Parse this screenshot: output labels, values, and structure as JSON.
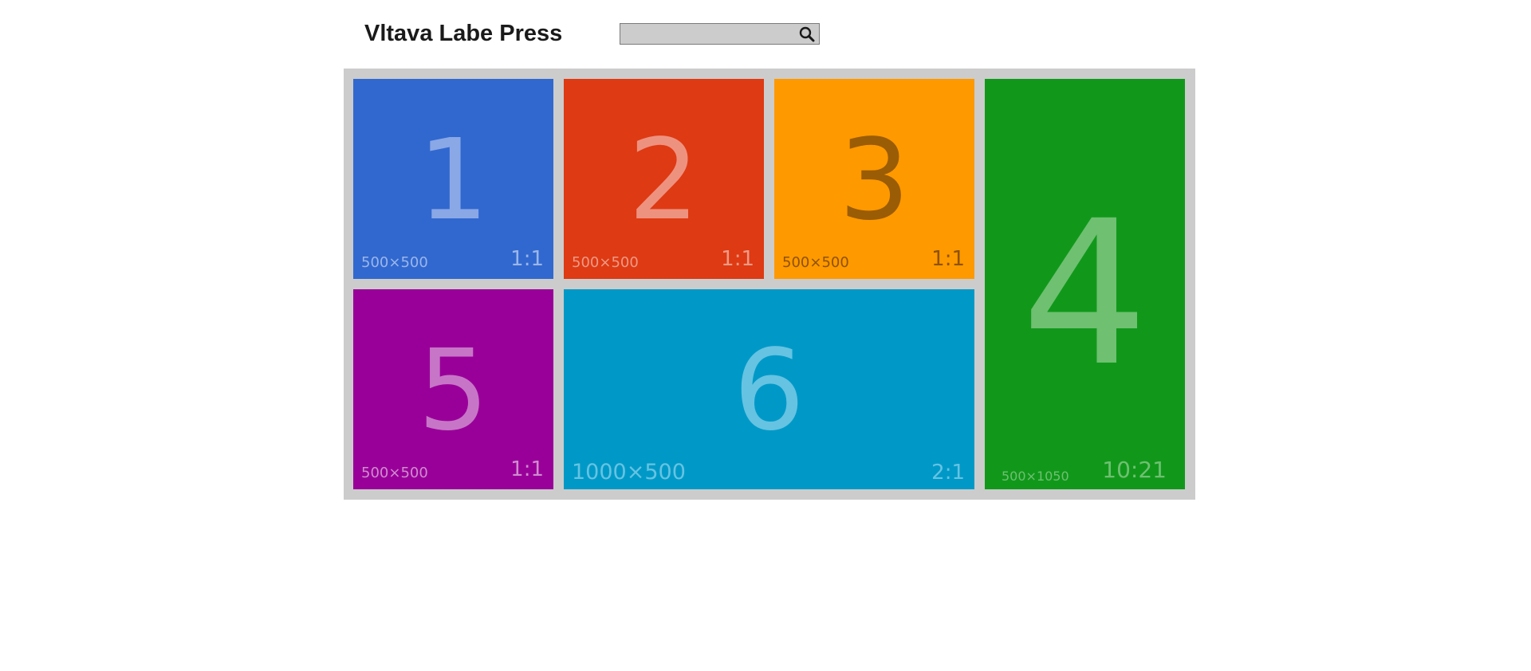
{
  "header": {
    "site_title": "Vltava Labe Press",
    "search_placeholder": "",
    "search_value": ""
  },
  "tiles": [
    {
      "number": "1",
      "dimensions": "500×500",
      "ratio": "1:1",
      "bg_color": "#3168cf",
      "number_color": "#8aa8e6",
      "label_color": "#9bb6ea"
    },
    {
      "number": "2",
      "dimensions": "500×500",
      "ratio": "1:1",
      "bg_color": "#de3a13",
      "number_color": "#ee9280",
      "label_color": "#ee9a86"
    },
    {
      "number": "3",
      "dimensions": "500×500",
      "ratio": "1:1",
      "bg_color": "#ff9900",
      "number_color": "#9a5c05",
      "label_color": "#8c5204"
    },
    {
      "number": "4",
      "dimensions": "500×1050",
      "ratio": "10:21",
      "bg_color": "#11981b",
      "number_color": "#6fc071",
      "label_color": "#6fc071"
    },
    {
      "number": "5",
      "dimensions": "500×500",
      "ratio": "1:1",
      "bg_color": "#990099",
      "number_color": "#c776c7",
      "label_color": "#cf8ccf"
    },
    {
      "number": "6",
      "dimensions": "1000×500",
      "ratio": "2:1",
      "bg_color": "#0099c7",
      "number_color": "#66c3e2",
      "label_color": "#66c3e2"
    }
  ]
}
